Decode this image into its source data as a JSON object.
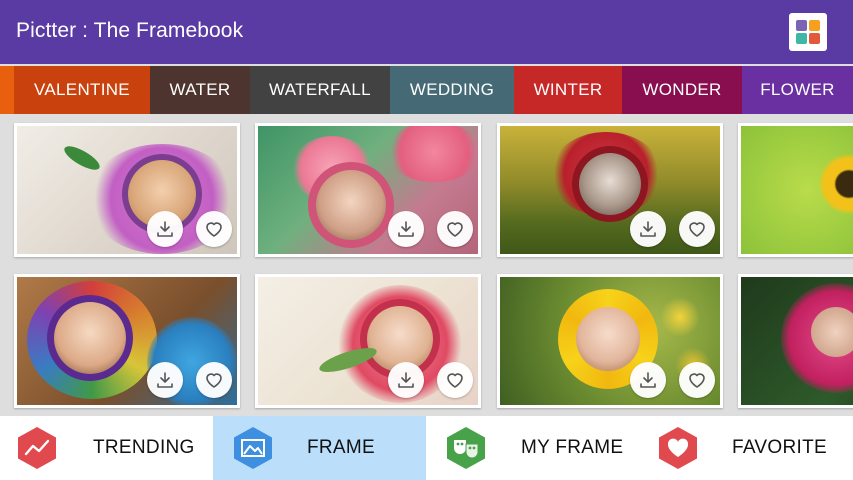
{
  "app": {
    "title": "Pictter : The Framebook",
    "menu_icon": "grid-icon",
    "menu_colors": [
      "#7b64b5",
      "#f6a01f",
      "#3fb6a6",
      "#e25a3c"
    ],
    "bar_color": "#5a3aa3"
  },
  "categories": [
    {
      "label": "VALENTINE",
      "color": "#c9420d"
    },
    {
      "label": "WATER",
      "color": "#4e342e"
    },
    {
      "label": "WATERFALL",
      "color": "#424242"
    },
    {
      "label": "WEDDING",
      "color": "#456975"
    },
    {
      "label": "WINTER",
      "color": "#c62828"
    },
    {
      "label": "WONDER",
      "color": "#880e4f"
    },
    {
      "label": "FLOWER",
      "color": "#6a2fa0"
    }
  ],
  "frames": {
    "download_icon": "download-icon",
    "favorite_icon": "heart-outline-icon",
    "items": [
      {
        "name": "frame-pink-flower"
      },
      {
        "name": "frame-pink-rose"
      },
      {
        "name": "frame-red-rose-grass"
      },
      {
        "name": "frame-sunflower-partial"
      },
      {
        "name": "frame-rainbow-rose"
      },
      {
        "name": "frame-red-rose-white"
      },
      {
        "name": "frame-sunflower"
      },
      {
        "name": "frame-magenta-rose-partial"
      }
    ]
  },
  "nav": {
    "active": "FRAME",
    "tabs": [
      {
        "label": "TRENDING",
        "icon": "trending-icon",
        "color": "#e04a4f"
      },
      {
        "label": "FRAME",
        "icon": "frame-icon",
        "color": "#3f8fe0"
      },
      {
        "label": "MY FRAME",
        "icon": "theater-masks-icon",
        "color": "#47a24a"
      },
      {
        "label": "FAVORITE",
        "icon": "heart-icon",
        "color": "#e04a4f"
      }
    ]
  }
}
